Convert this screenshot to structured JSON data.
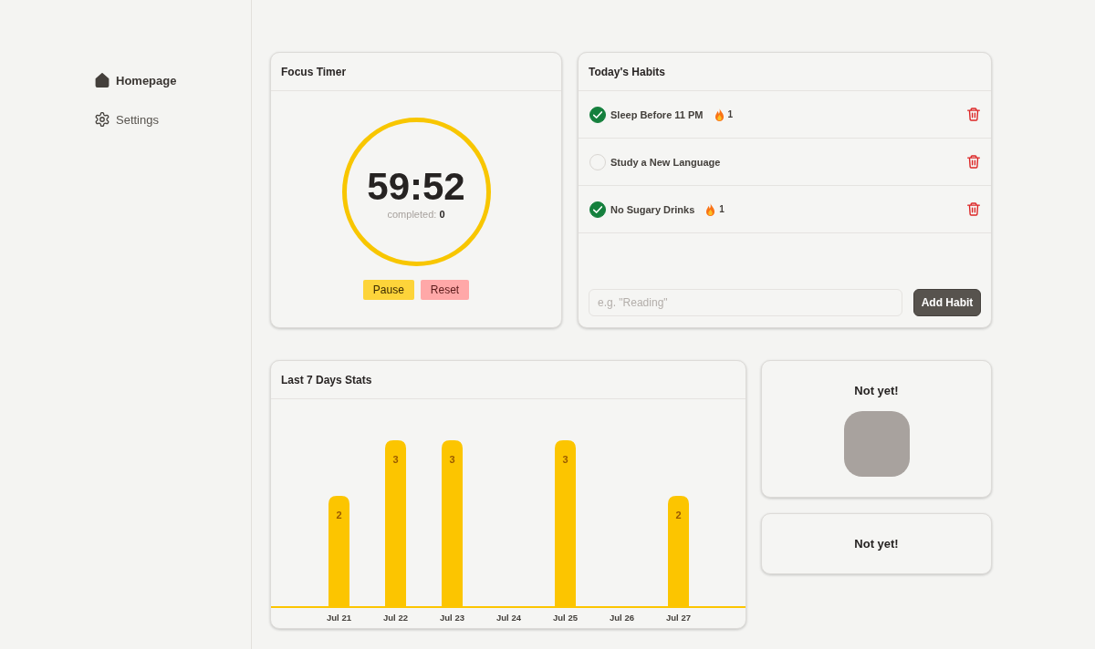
{
  "sidebar": {
    "items": [
      {
        "label": "Homepage",
        "selected": true
      },
      {
        "label": "Settings",
        "selected": false
      }
    ]
  },
  "focus_timer": {
    "title": "Focus Timer",
    "time": "59:52",
    "completed": "completed: **0**",
    "buttons": [
      {
        "label": "Pause",
        "kind": "pause"
      },
      {
        "label": "Reset",
        "kind": "reset"
      }
    ]
  },
  "habits": {
    "title": "Today's Habits",
    "items": [
      {
        "name": "Sleep Before 11 PM",
        "checked": true,
        "streak": "1"
      },
      {
        "name": "Study a New Language",
        "checked": false
      },
      {
        "name": "No Sugary Drinks",
        "checked": true,
        "streak": "1"
      }
    ],
    "input": {
      "placeholder": "e.g. \"Reading\""
    },
    "add_button": "Add Habit"
  },
  "stats": {
    "title": "Last 7 Days Stats",
    "chart_data": [
      {
        "type": "bar",
        "categories": [
          "Jul 21",
          "Jul 22",
          "Jul 23",
          "Jul 24",
          "Jul 25",
          "Jul 26",
          "Jul 27"
        ],
        "values": [
          2,
          3,
          3,
          0,
          3,
          0,
          2
        ],
        "color": "#fcc500",
        "value_labels": [
          "2",
          "3",
          "3",
          null,
          "3",
          null,
          "2"
        ],
        "tick_labels": "x"
      }
    ]
  },
  "badges": [
    {
      "title": "Not yet!",
      "kind": "picture"
    },
    {
      "title": "Not yet!",
      "kind": "text"
    }
  ]
}
